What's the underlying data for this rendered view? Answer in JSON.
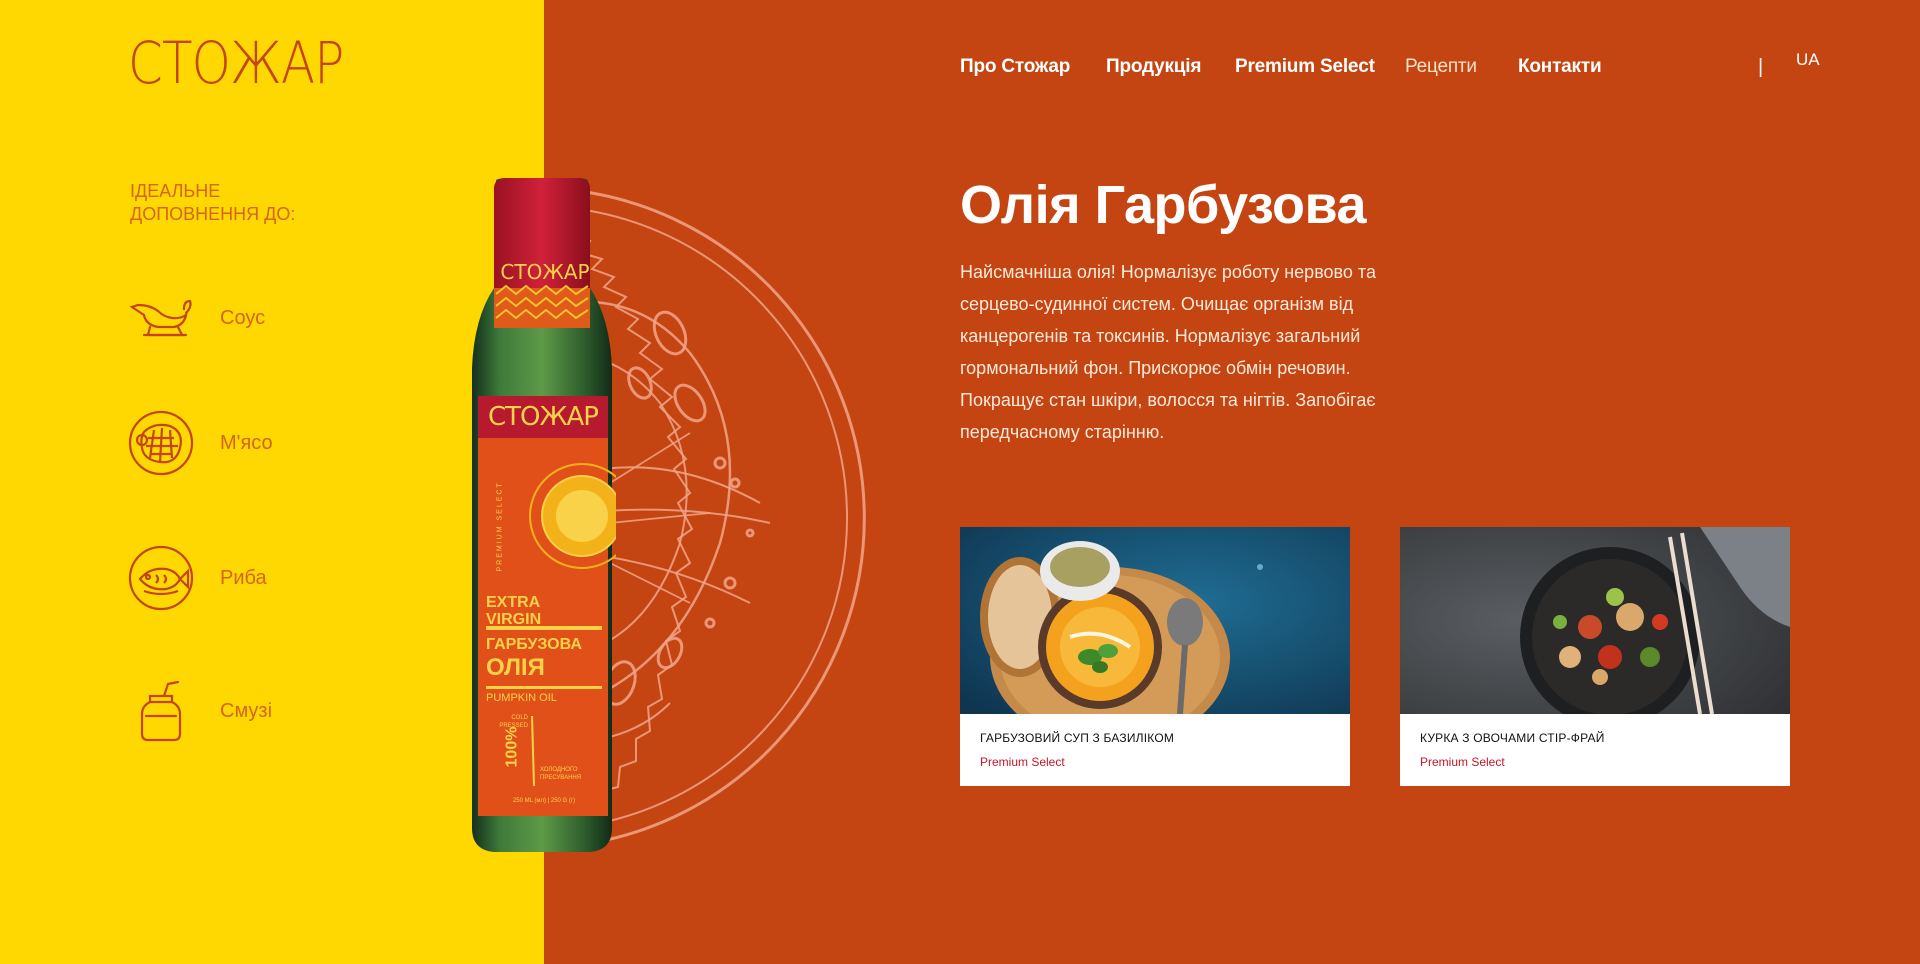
{
  "brand": {
    "logo_text": "СТОЖАР"
  },
  "nav": {
    "items": [
      {
        "label": "Про Стожар",
        "active": false
      },
      {
        "label": "Продукція",
        "active": false
      },
      {
        "label": "Premium Select",
        "active": false
      },
      {
        "label": "Рецепти",
        "active": true
      },
      {
        "label": "Контакти",
        "active": false
      }
    ],
    "separator": "|",
    "language": "UA"
  },
  "pairing": {
    "title": "Ідеальне доповнення до:",
    "items": [
      {
        "label": "Соус",
        "icon": "sauce-boat-icon"
      },
      {
        "label": "М'ясо",
        "icon": "meat-icon"
      },
      {
        "label": "Риба",
        "icon": "fish-icon"
      },
      {
        "label": "Смузі",
        "icon": "smoothie-jar-icon"
      }
    ]
  },
  "product": {
    "title": "Олія Гарбузова",
    "description": "Найсмачніша олія! Нормалізує роботу нервово та серцево-судинної систем. Очищає організм від канцерогенів та токсинів. Нормалізує загальний гормональний фон. Прискорює обмін речовин. Покращує стан шкіри, волосся та нігтів. Запобігає передчасному старінню.",
    "bottle_label": {
      "brand": "СТОЖАР",
      "line": "PREMIUM SELECT",
      "grade": "EXTRA VIRGIN",
      "name_line1": "ГАРБУЗОВА",
      "name_line2": "ОЛІЯ",
      "name_en": "PUMPKIN OIL",
      "cold": "COLD PRESSED",
      "percent": "100%",
      "pressing": "холодного пресування",
      "volume": "250 ML (мл)  |  250 G (г)"
    }
  },
  "recipes": [
    {
      "title": "Гарбузовий суп з базиліком",
      "tag": "Premium Select"
    },
    {
      "title": "Курка з овочами стір-фрай",
      "tag": "Premium Select"
    }
  ],
  "colors": {
    "yellow": "#fed800",
    "rust": "#c44512",
    "icon_orange": "#d86418",
    "tag_red": "#c7152b"
  }
}
